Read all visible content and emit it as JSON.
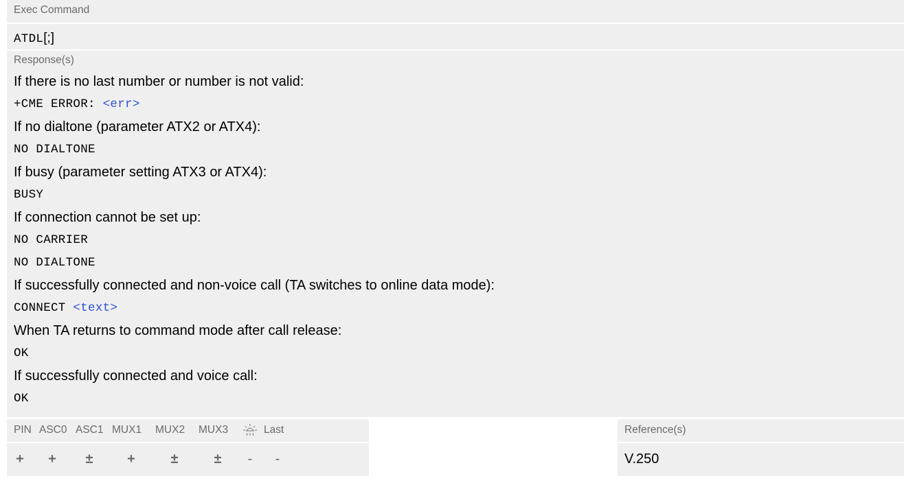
{
  "exec_command": {
    "label": "Exec Command",
    "syntax_cmd": "ATDL",
    "syntax_suffix": "[;]"
  },
  "responses": {
    "label": "Response(s)",
    "lines": [
      {
        "text": "If there is no last number or number is not valid:"
      },
      {
        "code": "+CME ERROR: ",
        "param": "<err>"
      },
      {
        "text": "If no dialtone (parameter ATX2 or ATX4):"
      },
      {
        "code": "NO DIALTONE"
      },
      {
        "text": "If busy (parameter setting ATX3 or ATX4):"
      },
      {
        "code": "BUSY"
      },
      {
        "text": "If connection cannot be set up:"
      },
      {
        "code": "NO CARRIER"
      },
      {
        "code": "NO DIALTONE"
      },
      {
        "text": "If successfully connected and non-voice call (TA switches to online data mode):"
      },
      {
        "code": "CONNECT ",
        "param": "<text>"
      },
      {
        "text": "When TA returns to command mode after call release:"
      },
      {
        "code": "OK"
      },
      {
        "text": "If successfully connected and voice call:"
      },
      {
        "code": "OK"
      }
    ]
  },
  "pin_table": {
    "headers": [
      "PIN",
      "ASC0",
      "ASC1",
      "MUX1",
      "MUX2",
      "MUX3",
      "sun-icon",
      "Last"
    ],
    "header_labels": {
      "pin": "PIN",
      "asc0": "ASC0",
      "asc1": "ASC1",
      "mux1": "MUX1",
      "mux2": "MUX2",
      "mux3": "MUX3",
      "last": "Last"
    },
    "values": {
      "pin": "+",
      "asc0": "+",
      "asc1": "±",
      "mux1": "+",
      "mux2": "±",
      "mux3": "±",
      "sun": "-",
      "last": "-"
    }
  },
  "reference": {
    "label": "Reference(s)",
    "value": "V.250"
  },
  "colors": {
    "background_panel": "#efefef",
    "label_gray": "#6a6a6a",
    "parameter_blue": "#2a4fd6"
  }
}
